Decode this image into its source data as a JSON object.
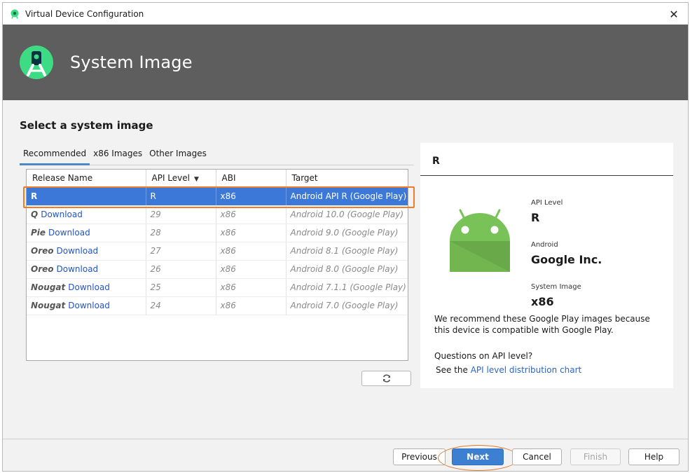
{
  "window": {
    "title": "Virtual Device Configuration"
  },
  "banner": {
    "title": "System Image"
  },
  "page": {
    "heading": "Select a system image"
  },
  "tabs": [
    {
      "label": "Recommended",
      "active": true
    },
    {
      "label": "x86 Images",
      "active": false
    },
    {
      "label": "Other Images",
      "active": false
    }
  ],
  "table": {
    "columns": [
      "Release Name",
      "API Level",
      "ABI",
      "Target"
    ],
    "rows": [
      {
        "release": "R",
        "download": "",
        "api": "R",
        "abi": "x86",
        "target": "Android API R (Google Play)",
        "selected": true
      },
      {
        "release": "Q",
        "download": "Download",
        "api": "29",
        "abi": "x86",
        "target": "Android 10.0 (Google Play)",
        "selected": false
      },
      {
        "release": "Pie",
        "download": "Download",
        "api": "28",
        "abi": "x86",
        "target": "Android 9.0 (Google Play)",
        "selected": false
      },
      {
        "release": "Oreo",
        "download": "Download",
        "api": "27",
        "abi": "x86",
        "target": "Android 8.1 (Google Play)",
        "selected": false
      },
      {
        "release": "Oreo",
        "download": "Download",
        "api": "26",
        "abi": "x86",
        "target": "Android 8.0 (Google Play)",
        "selected": false
      },
      {
        "release": "Nougat",
        "download": "Download",
        "api": "25",
        "abi": "x86",
        "target": "Android 7.1.1 (Google Play)",
        "selected": false
      },
      {
        "release": "Nougat",
        "download": "Download",
        "api": "24",
        "abi": "x86",
        "target": "Android 7.0 (Google Play)",
        "selected": false
      }
    ]
  },
  "detail": {
    "title": "R",
    "api_level_label": "API Level",
    "api_level_value": "R",
    "android_label": "Android",
    "android_value": "Google Inc.",
    "system_image_label": "System Image",
    "system_image_value": "x86",
    "recommend_text": "We recommend these Google Play images because this device is compatible with Google Play.",
    "question": "Questions on API level?",
    "see_prefix": "See the ",
    "see_link": "API level distribution chart"
  },
  "footer": {
    "previous": "Previous",
    "next": "Next",
    "cancel": "Cancel",
    "finish": "Finish",
    "help": "Help"
  },
  "colors": {
    "accent": "#3b78d8",
    "highlight": "#f07c27",
    "android_green": "#78c257",
    "banner": "#5e5e5e"
  },
  "icons": {
    "app": "android-studio-icon",
    "close": "close-icon",
    "refresh": "refresh-icon",
    "sort": "sort-desc-icon",
    "robot": "android-robot-icon"
  }
}
